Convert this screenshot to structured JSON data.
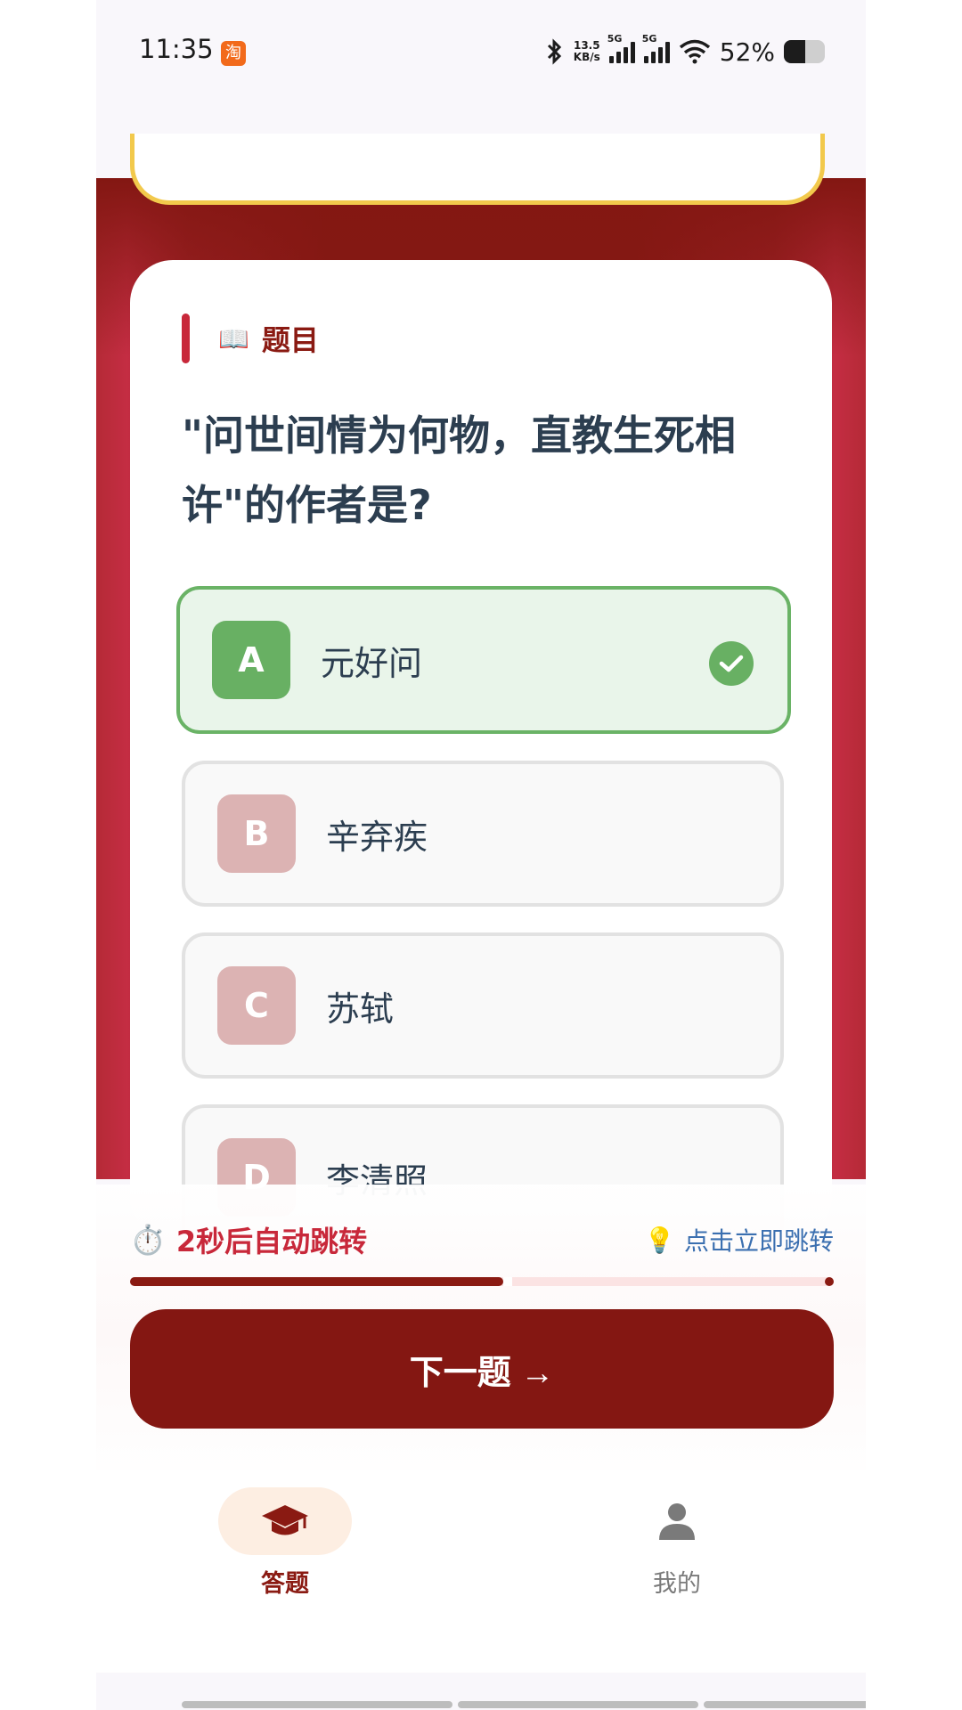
{
  "status_bar": {
    "time": "11:35",
    "taobao_icon_text": "淘",
    "net_speed_value": "13.5",
    "net_speed_unit": "KB/s",
    "sim1_label": "5G",
    "sim2_label": "5G",
    "battery_text": "52%",
    "battery_level": 0.52
  },
  "question": {
    "label_icon": "📖",
    "label": "题目",
    "text": "\"问世间情为何物，直教生死相许\"的作者是?"
  },
  "options": [
    {
      "letter": "A",
      "text": "元好问",
      "state": "correct"
    },
    {
      "letter": "B",
      "text": "辛弃疾",
      "state": "normal"
    },
    {
      "letter": "C",
      "text": "苏轼",
      "state": "normal"
    },
    {
      "letter": "D",
      "text": "李清照",
      "state": "normal"
    }
  ],
  "timer": {
    "icon": "⏱️",
    "text": "2秒后自动跳转",
    "hint_icon": "💡",
    "hint": "点击立即跳转",
    "progress": 0.54
  },
  "next_button": {
    "label": "下一题 →"
  },
  "nav": {
    "items": [
      {
        "label": "答题",
        "icon": "graduation-cap-icon",
        "active": true
      },
      {
        "label": "我的",
        "icon": "user-icon",
        "active": false
      }
    ]
  },
  "colors": {
    "primary_dark_red": "#841712",
    "accent_red": "#c8283a",
    "correct_green": "#68b063",
    "option_badge_pink": "#dcb3b3",
    "hint_blue": "#3b6fb0"
  }
}
